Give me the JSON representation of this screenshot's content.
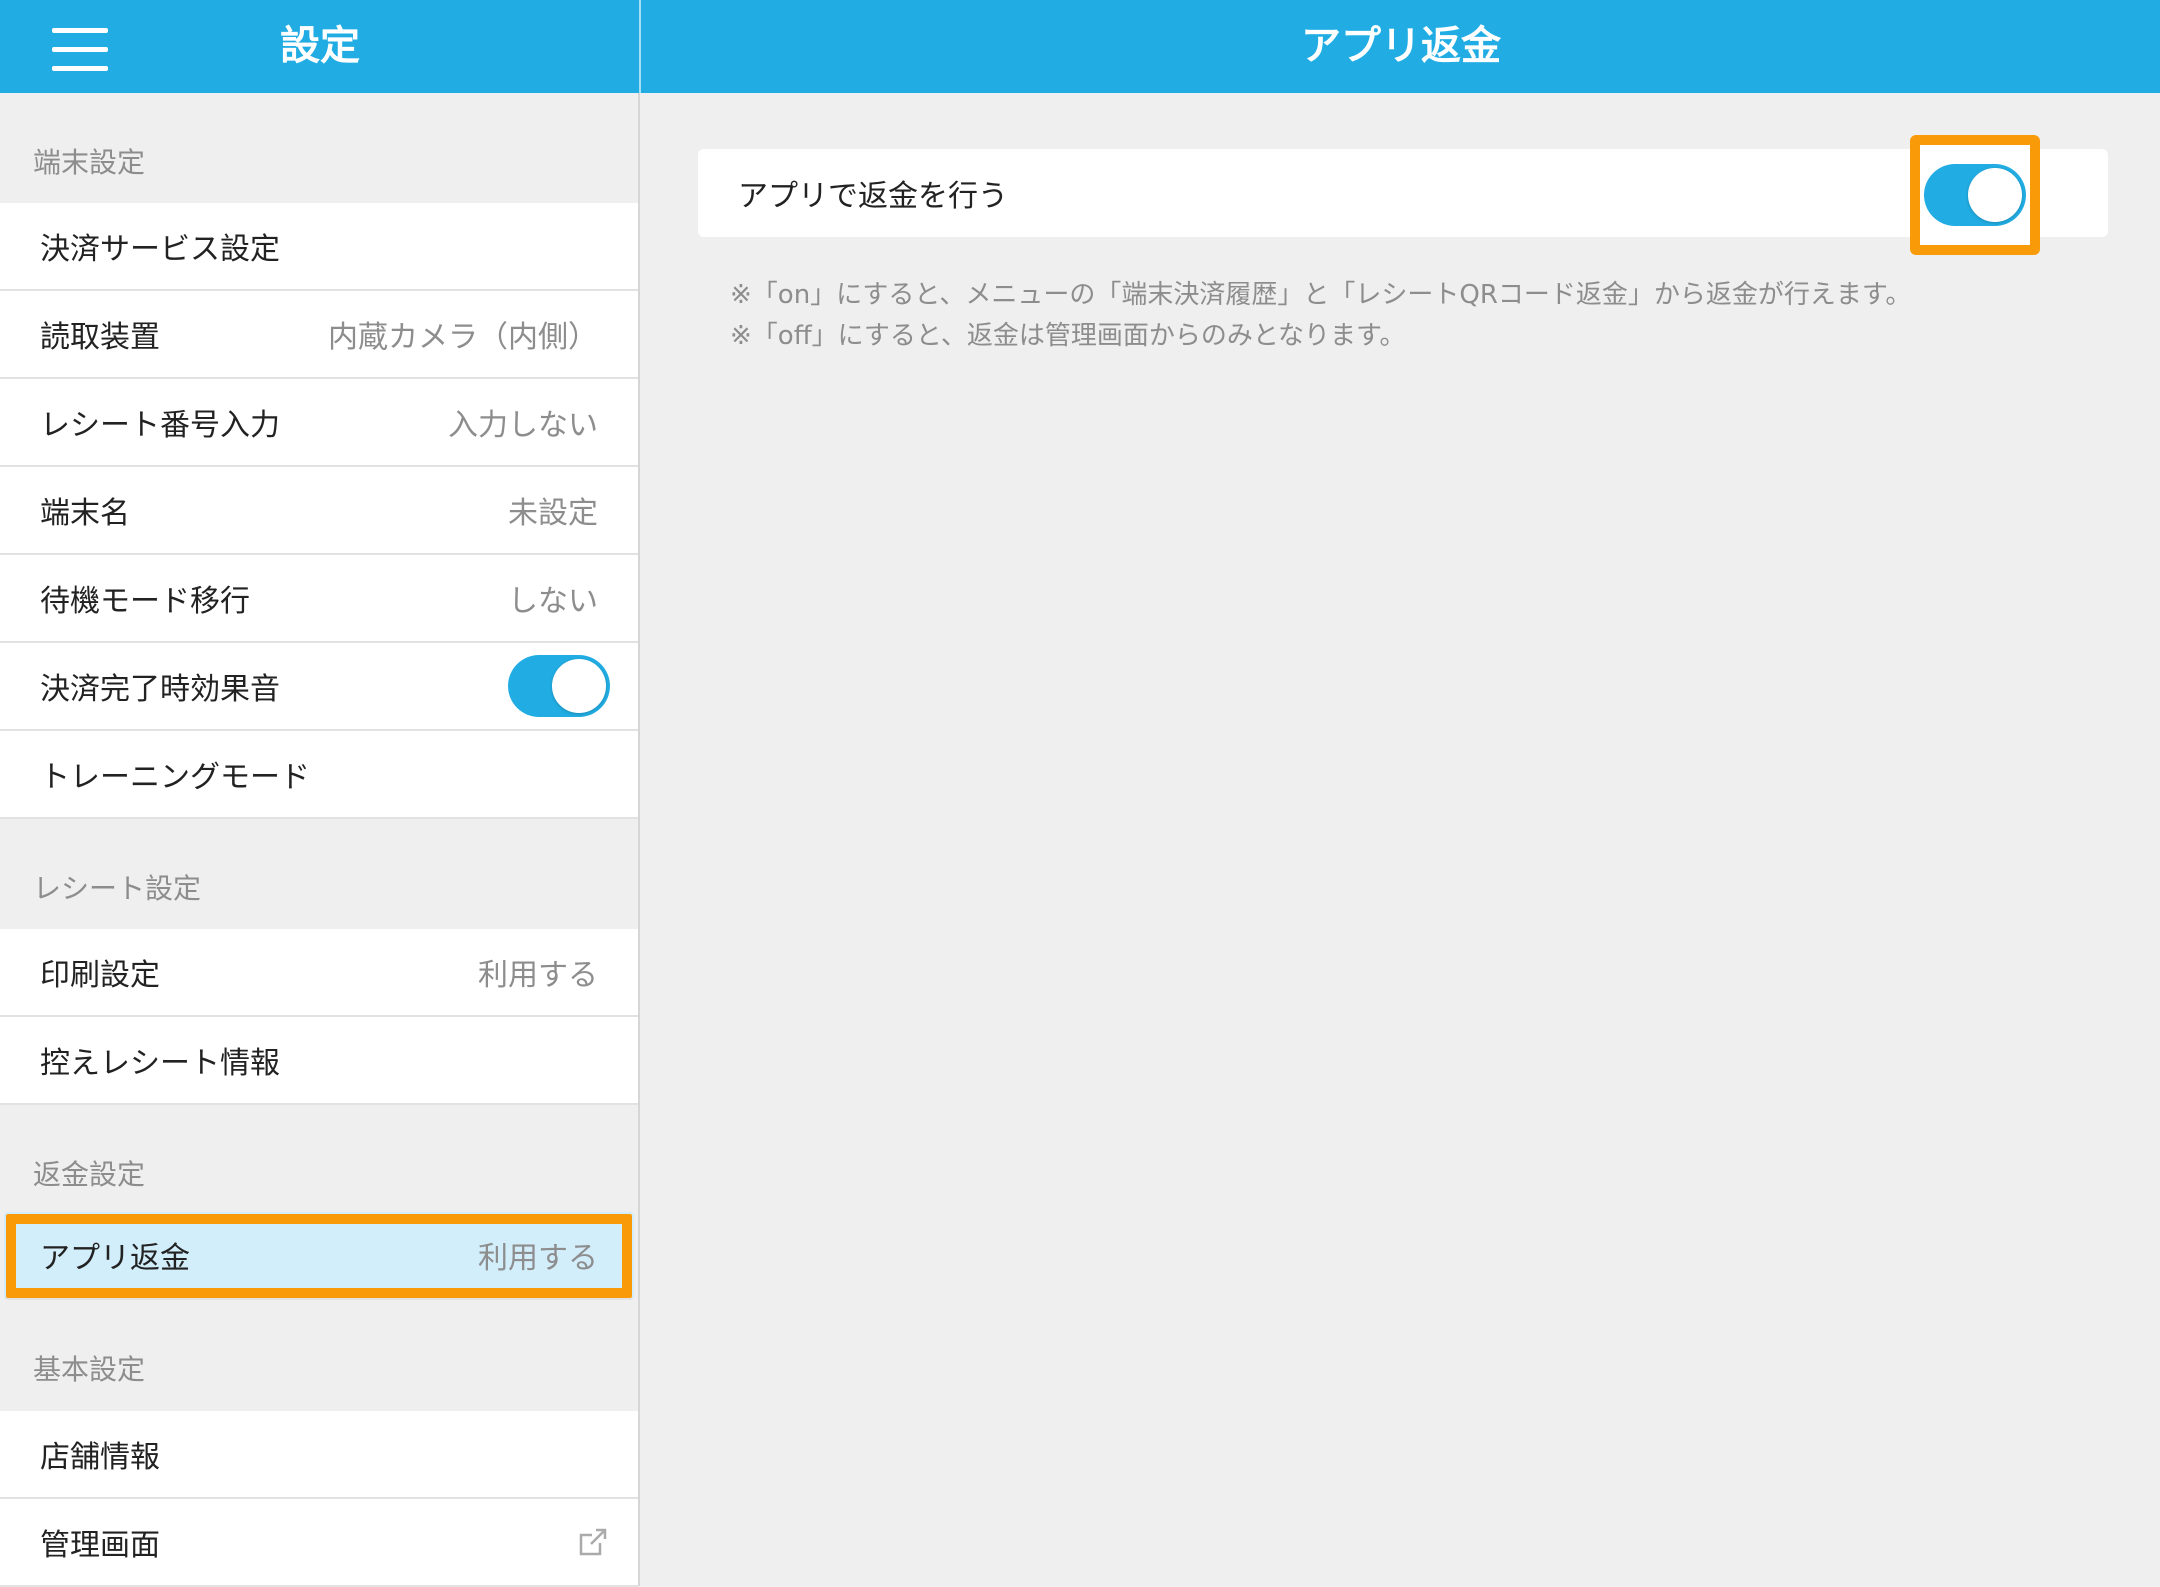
{
  "header": {
    "sidebar_title": "設定",
    "main_title": "アプリ返金",
    "color": "#21ade3"
  },
  "sidebar": {
    "sections": [
      {
        "title": "端末設定",
        "items": [
          {
            "label": "決済サービス設定",
            "value": ""
          },
          {
            "label": "読取装置",
            "value": "内蔵カメラ（内側）"
          },
          {
            "label": "レシート番号入力",
            "value": "入力しない"
          },
          {
            "label": "端末名",
            "value": "未設定"
          },
          {
            "label": "待機モード移行",
            "value": "しない"
          },
          {
            "label": "決済完了時効果音",
            "value": "",
            "toggle": true,
            "toggle_state": "on"
          },
          {
            "label": "トレーニングモード",
            "value": ""
          }
        ]
      },
      {
        "title": "レシート設定",
        "items": [
          {
            "label": "印刷設定",
            "value": "利用する"
          },
          {
            "label": "控えレシート情報",
            "value": ""
          }
        ]
      },
      {
        "title": "返金設定",
        "items": [
          {
            "label": "アプリ返金",
            "value": "利用する",
            "selected": true
          }
        ]
      },
      {
        "title": "基本設定",
        "items": [
          {
            "label": "店舗情報",
            "value": ""
          },
          {
            "label": "管理画面",
            "value": "",
            "icon": "external-link-icon"
          }
        ]
      }
    ]
  },
  "main": {
    "setting_label": "アプリで返金を行う",
    "setting_toggle_state": "on",
    "notes": [
      "※「on」にすると、メニューの「端末決済履歴」と「レシートQRコード返金」から返金が行えます。",
      "※「off」にすると、返金は管理画面からのみとなります。"
    ]
  },
  "highlight_color": "#f99b09"
}
